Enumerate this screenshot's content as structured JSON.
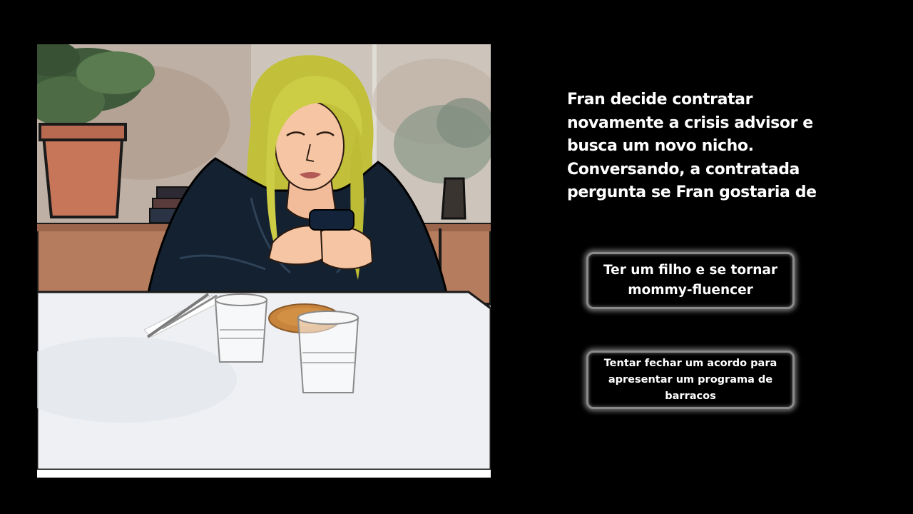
{
  "game": {
    "narration": "Fran decide contratar novamente a crisis advisor e busca um novo nicho. Conversando, a contratada pergunta se Fran gostaria de",
    "choices": [
      {
        "label": "Ter um filho e se tornar mommy-fluencer"
      },
      {
        "label": "Tentar fechar um acordo para apresentar um programa de barracos"
      }
    ]
  },
  "colors": {
    "background": "#000000",
    "text": "#ffffff",
    "choice_border": "#8a8a8a",
    "hair": "#c2c03a",
    "jacket": "#142130",
    "skin": "#f6c5a4",
    "table": "#eef0f3"
  }
}
